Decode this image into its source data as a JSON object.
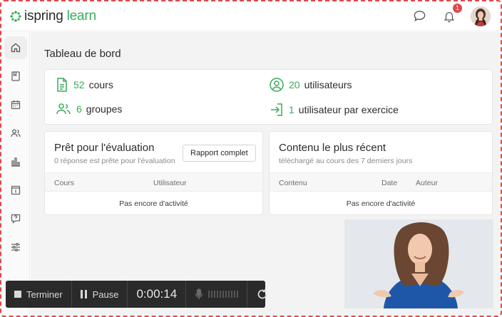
{
  "app": {
    "logo_part1": "ispring",
    "logo_part2": " learn"
  },
  "header": {
    "notification_count": "1"
  },
  "sidebar": {
    "items": [
      {
        "icon": "home-icon",
        "active": true
      },
      {
        "icon": "book-icon"
      },
      {
        "icon": "calendar-icon"
      },
      {
        "icon": "users-icon"
      },
      {
        "icon": "bar-chart-icon"
      },
      {
        "icon": "info-icon"
      },
      {
        "icon": "question-icon"
      },
      {
        "icon": "sliders-icon"
      }
    ]
  },
  "main": {
    "title": "Tableau de bord",
    "stats": {
      "courses": {
        "num": "52",
        "label": "cours"
      },
      "users": {
        "num": "20",
        "label": "utilisateurs"
      },
      "groups": {
        "num": "6",
        "label": "groupes"
      },
      "per_exercise": {
        "num": "1",
        "label": "utilisateur par exercice"
      }
    },
    "evaluation": {
      "title": "Prêt pour l'évaluation",
      "subtitle": "0 réponse est prête pour l'évaluation",
      "button": "Rapport complet",
      "columns": [
        "Cours",
        "Utilisateur"
      ],
      "empty": "Pas encore d'activité"
    },
    "recent": {
      "title": "Contenu le plus récent",
      "subtitle": "téléchargé au cours des 7 derniers jours",
      "columns": [
        "Contenu",
        "Date",
        "Auteur"
      ],
      "empty": "Pas encore d'activité"
    }
  },
  "recorder": {
    "stop_label": "Terminer",
    "pause_label": "Pause",
    "timer": "0:00:14"
  },
  "colors": {
    "accent": "#3aaa5b",
    "badge": "#e0474c",
    "frame": "#e0474c"
  }
}
